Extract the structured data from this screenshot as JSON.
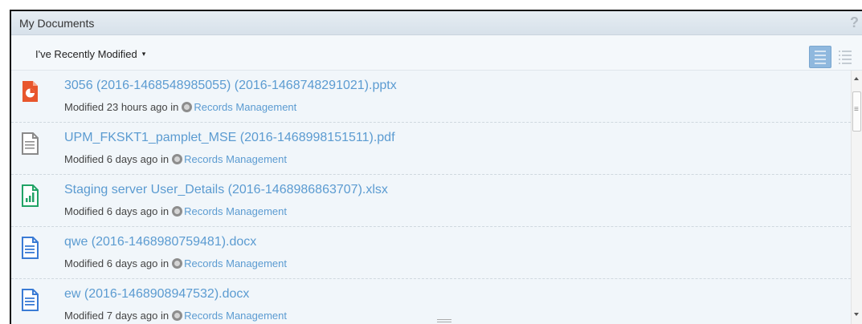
{
  "dashlet": {
    "title": "My Documents",
    "help": "?"
  },
  "toolbar": {
    "filter_label": "I've Recently Modified",
    "filter_caret": "▾",
    "views": [
      {
        "name": "detailed-view",
        "active": true
      },
      {
        "name": "simple-view",
        "active": false
      }
    ]
  },
  "documents": [
    {
      "name": "3056 (2016-1468548985055) (2016-1468748291021).pptx",
      "meta_prefix": "Modified 23 hours ago in",
      "site": "Records Management",
      "icon": "powerpoint-icon",
      "icon_color": "#e8562c"
    },
    {
      "name": "UPM_FKSKT1_pamplet_MSE (2016-1468998151511).pdf",
      "meta_prefix": "Modified 6 days ago in",
      "site": "Records Management",
      "icon": "generic-document-icon",
      "icon_color": "#8a8a8a"
    },
    {
      "name": "Staging server User_Details (2016-1468986863707).xlsx",
      "meta_prefix": "Modified 6 days ago in",
      "site": "Records Management",
      "icon": "excel-icon",
      "icon_color": "#21a366"
    },
    {
      "name": "qwe (2016-1468980759481).docx",
      "meta_prefix": "Modified 6 days ago in",
      "site": "Records Management",
      "icon": "word-icon",
      "icon_color": "#3a7bd5"
    },
    {
      "name": "ew (2016-1468908947532).docx",
      "meta_prefix": "Modified 7 days ago in",
      "site": "Records Management",
      "icon": "word-icon",
      "icon_color": "#3a7bd5"
    }
  ]
}
